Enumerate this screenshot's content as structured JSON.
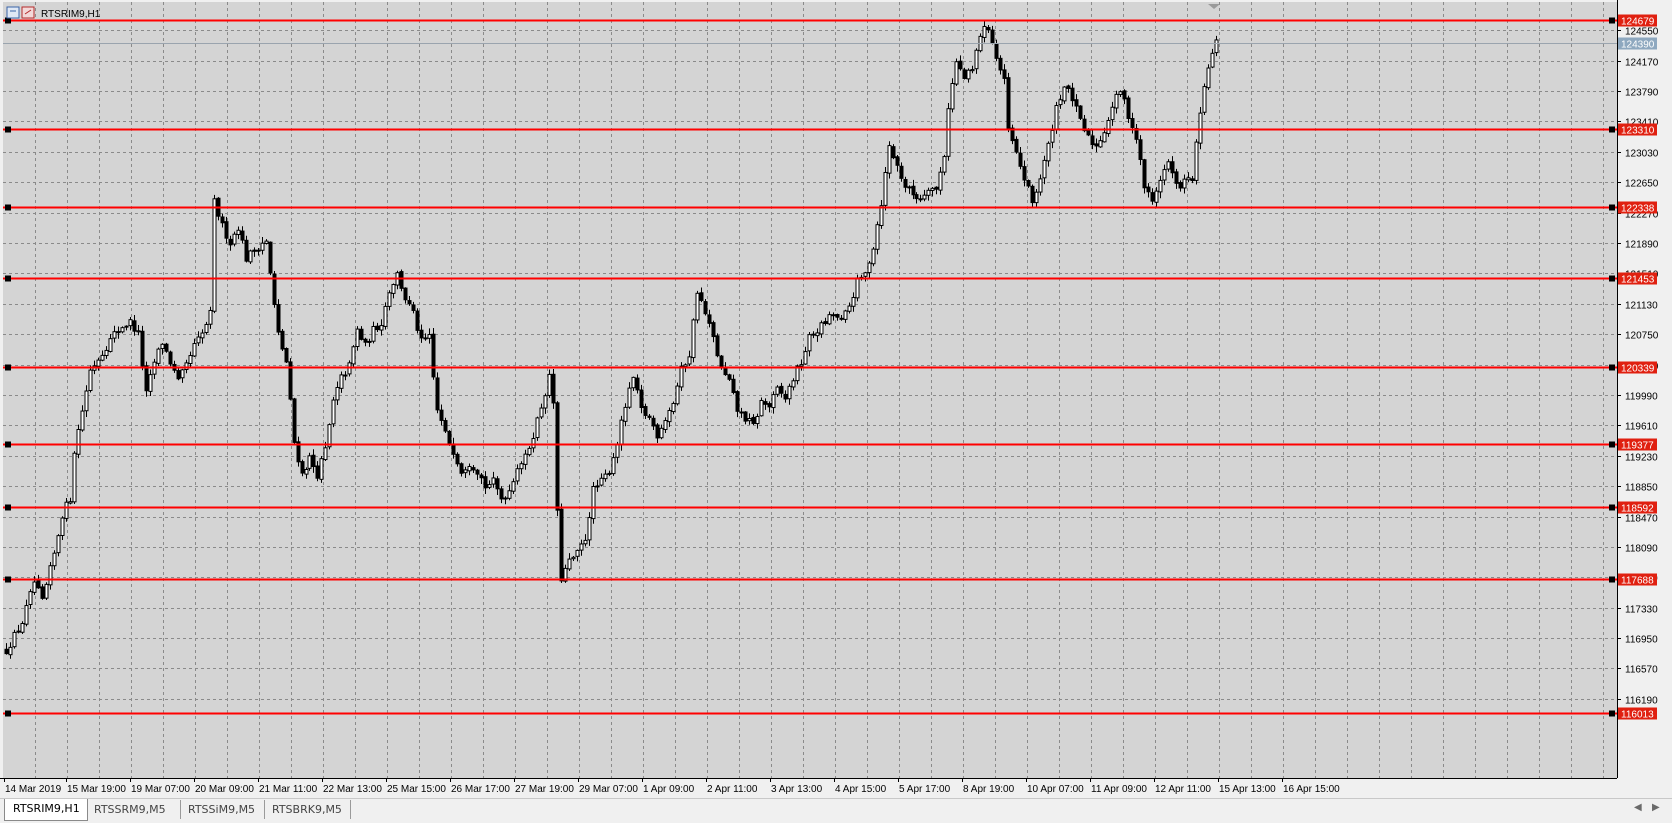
{
  "chart_title": "RTSRIM9,H1",
  "colors": {
    "background": "#d4d4d4",
    "grid": "#8a8a8a",
    "candle": "#000000",
    "level_line": "#ff0000",
    "level_label_bg": "#e02010",
    "current_price_label_bg": "#8ea8bf"
  },
  "icons": [
    "chart-window-icon",
    "chart-props-icon",
    "scroll-left-icon",
    "scroll-right-icon",
    "shift-marker-icon"
  ],
  "tabs": [
    {
      "label": "RTSRIM9,H1",
      "active": true
    },
    {
      "label": "RTSSRM9,M5",
      "active": false
    },
    {
      "label": "RTSSiM9,M5",
      "active": false
    },
    {
      "label": "RTSBRK9,M5",
      "active": false
    }
  ],
  "chart_data": {
    "type": "candlestick",
    "title": "RTSRIM9,H1",
    "y_range": [
      115800,
      124950
    ],
    "y_ticks": [
      124550,
      124170,
      123790,
      123410,
      123030,
      122650,
      122270,
      121890,
      121510,
      121130,
      120750,
      120370,
      119990,
      119610,
      119230,
      118850,
      118470,
      118090,
      117710,
      117330,
      116950,
      116570,
      116190
    ],
    "x_labels": [
      "14 Mar 2019",
      "15 Mar 19:00",
      "19 Mar 07:00",
      "20 Mar 09:00",
      "21 Mar 11:00",
      "22 Mar 13:00",
      "25 Mar 15:00",
      "26 Mar 17:00",
      "27 Mar 19:00",
      "29 Mar 07:00",
      "1 Apr 09:00",
      "2 Apr 11:00",
      "3 Apr 13:00",
      "4 Apr 15:00",
      "5 Apr 17:00",
      "8 Apr 19:00",
      "10 Apr 07:00",
      "11 Apr 09:00",
      "12 Apr 11:00",
      "15 Apr 13:00",
      "16 Apr 15:00"
    ],
    "grid": true,
    "current_price": "124390",
    "levels": [
      "124679",
      "123310",
      "122338",
      "121453",
      "120339",
      "119377",
      "118592",
      "117688",
      "116013"
    ],
    "close_path": [
      [
        0,
        116800
      ],
      [
        4,
        117150
      ],
      [
        7,
        117650
      ],
      [
        9,
        117400
      ],
      [
        12,
        118000
      ],
      [
        14,
        118500
      ],
      [
        16,
        118700
      ],
      [
        17,
        119300
      ],
      [
        19,
        119800
      ],
      [
        21,
        120300
      ],
      [
        23,
        120450
      ],
      [
        25,
        120600
      ],
      [
        27,
        120750
      ],
      [
        29,
        120850
      ],
      [
        31,
        120900
      ],
      [
        33,
        120750
      ],
      [
        35,
        120000
      ],
      [
        37,
        120400
      ],
      [
        39,
        120650
      ],
      [
        41,
        120400
      ],
      [
        43,
        120150
      ],
      [
        45,
        120350
      ],
      [
        47,
        120600
      ],
      [
        49,
        120750
      ],
      [
        51,
        121000
      ],
      [
        52,
        122400
      ],
      [
        54,
        122100
      ],
      [
        56,
        121900
      ],
      [
        58,
        122100
      ],
      [
        60,
        121700
      ],
      [
        62,
        121800
      ],
      [
        64,
        121900
      ],
      [
        65,
        121900
      ],
      [
        67,
        121100
      ],
      [
        68,
        120750
      ],
      [
        70,
        120400
      ],
      [
        72,
        119400
      ],
      [
        74,
        119000
      ],
      [
        76,
        119200
      ],
      [
        78,
        119000
      ],
      [
        80,
        119300
      ],
      [
        82,
        119900
      ],
      [
        84,
        120200
      ],
      [
        86,
        120350
      ],
      [
        88,
        120800
      ],
      [
        90,
        120600
      ],
      [
        92,
        120800
      ],
      [
        94,
        120900
      ],
      [
        96,
        121300
      ],
      [
        98,
        121500
      ],
      [
        100,
        121200
      ],
      [
        102,
        121000
      ],
      [
        104,
        120650
      ],
      [
        106,
        120700
      ],
      [
        107,
        120200
      ],
      [
        108,
        119800
      ],
      [
        110,
        119500
      ],
      [
        112,
        119300
      ],
      [
        114,
        119050
      ],
      [
        116,
        119150
      ],
      [
        118,
        119050
      ],
      [
        120,
        118850
      ],
      [
        122,
        118900
      ],
      [
        124,
        118700
      ],
      [
        126,
        118800
      ],
      [
        128,
        119100
      ],
      [
        130,
        119200
      ],
      [
        132,
        119500
      ],
      [
        134,
        119850
      ],
      [
        136,
        120200
      ],
      [
        137,
        119900
      ],
      [
        138,
        118500
      ],
      [
        139,
        117700
      ],
      [
        141,
        117900
      ],
      [
        143,
        118000
      ],
      [
        145,
        118200
      ],
      [
        147,
        118800
      ],
      [
        149,
        118900
      ],
      [
        151,
        119050
      ],
      [
        153,
        119400
      ],
      [
        155,
        119850
      ],
      [
        157,
        120200
      ],
      [
        159,
        119800
      ],
      [
        161,
        119700
      ],
      [
        163,
        119500
      ],
      [
        165,
        119700
      ],
      [
        167,
        119900
      ],
      [
        169,
        120300
      ],
      [
        171,
        120500
      ],
      [
        173,
        121300
      ],
      [
        175,
        121000
      ],
      [
        177,
        120700
      ],
      [
        179,
        120300
      ],
      [
        181,
        120150
      ],
      [
        183,
        119800
      ],
      [
        185,
        119700
      ],
      [
        187,
        119600
      ],
      [
        189,
        119900
      ],
      [
        191,
        119850
      ],
      [
        193,
        120050
      ],
      [
        195,
        119950
      ],
      [
        197,
        120200
      ],
      [
        199,
        120400
      ],
      [
        201,
        120700
      ],
      [
        203,
        120800
      ],
      [
        205,
        120900
      ],
      [
        207,
        121000
      ],
      [
        209,
        120900
      ],
      [
        211,
        121100
      ],
      [
        213,
        121400
      ],
      [
        215,
        121500
      ],
      [
        217,
        121850
      ],
      [
        219,
        122400
      ],
      [
        221,
        123100
      ],
      [
        223,
        122850
      ],
      [
        225,
        122600
      ],
      [
        227,
        122500
      ],
      [
        229,
        122450
      ],
      [
        231,
        122600
      ],
      [
        233,
        122550
      ],
      [
        235,
        123000
      ],
      [
        236,
        123600
      ],
      [
        238,
        124150
      ],
      [
        240,
        123950
      ],
      [
        242,
        124050
      ],
      [
        244,
        124500
      ],
      [
        246,
        124600
      ],
      [
        248,
        124200
      ],
      [
        250,
        123900
      ],
      [
        251,
        123300
      ],
      [
        253,
        123000
      ],
      [
        255,
        122700
      ],
      [
        257,
        122400
      ],
      [
        259,
        122700
      ],
      [
        261,
        123100
      ],
      [
        263,
        123600
      ],
      [
        265,
        123850
      ],
      [
        267,
        123700
      ],
      [
        269,
        123400
      ],
      [
        271,
        123200
      ],
      [
        273,
        123100
      ],
      [
        275,
        123300
      ],
      [
        277,
        123600
      ],
      [
        279,
        123800
      ],
      [
        281,
        123500
      ],
      [
        283,
        123200
      ],
      [
        285,
        122600
      ],
      [
        287,
        122400
      ],
      [
        289,
        122700
      ],
      [
        291,
        122900
      ],
      [
        293,
        122600
      ],
      [
        295,
        122650
      ],
      [
        297,
        122700
      ],
      [
        299,
        123500
      ],
      [
        301,
        124100
      ],
      [
        303,
        124390
      ]
    ]
  }
}
